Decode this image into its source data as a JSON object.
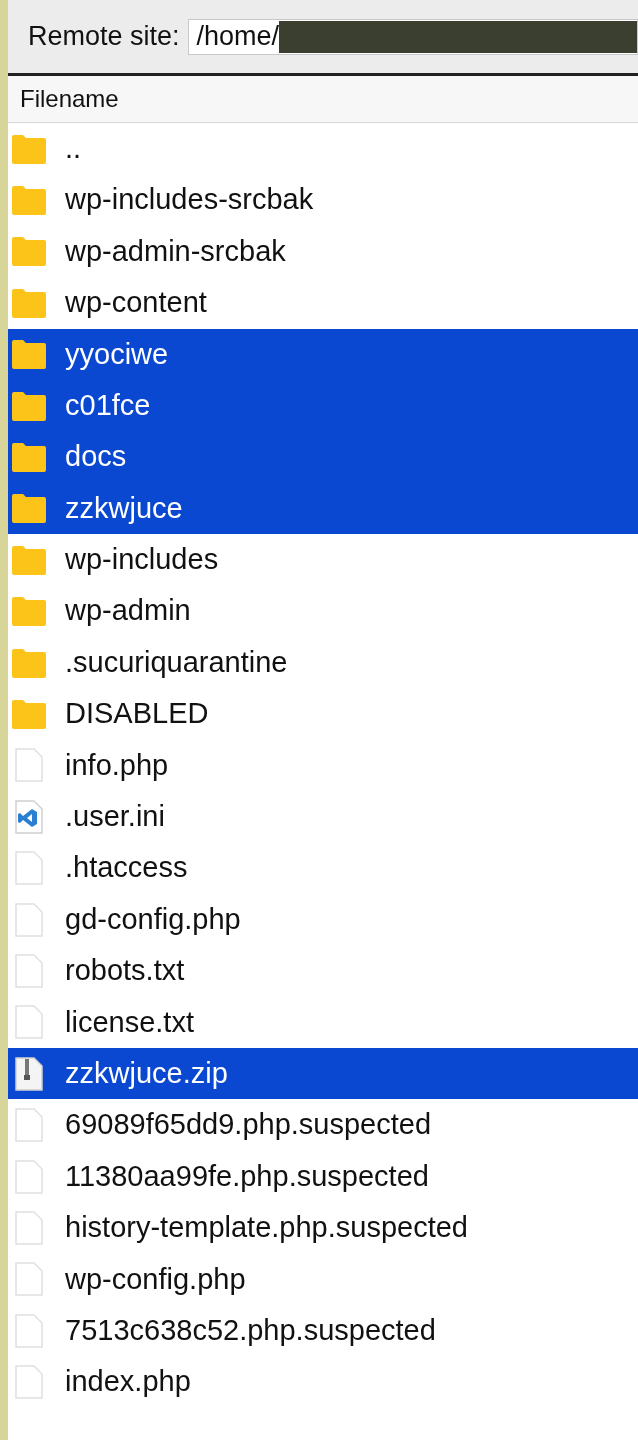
{
  "remote_site": {
    "label": "Remote site:",
    "path": "/home/"
  },
  "table": {
    "columns": [
      "Filename"
    ],
    "rows": [
      {
        "name": "..",
        "kind": "folder",
        "selected": false
      },
      {
        "name": "wp-includes-srcbak",
        "kind": "folder",
        "selected": false
      },
      {
        "name": "wp-admin-srcbak",
        "kind": "folder",
        "selected": false
      },
      {
        "name": "wp-content",
        "kind": "folder",
        "selected": false
      },
      {
        "name": "yyociwe",
        "kind": "folder",
        "selected": true
      },
      {
        "name": "c01fce",
        "kind": "folder",
        "selected": true
      },
      {
        "name": "docs",
        "kind": "folder",
        "selected": true
      },
      {
        "name": "zzkwjuce",
        "kind": "folder",
        "selected": true
      },
      {
        "name": "wp-includes",
        "kind": "folder",
        "selected": false
      },
      {
        "name": "wp-admin",
        "kind": "folder",
        "selected": false
      },
      {
        "name": ".sucuriquarantine",
        "kind": "folder",
        "selected": false
      },
      {
        "name": "DISABLED",
        "kind": "folder",
        "selected": false
      },
      {
        "name": "info.php",
        "kind": "file",
        "selected": false
      },
      {
        "name": ".user.ini",
        "kind": "code",
        "selected": false
      },
      {
        "name": ".htaccess",
        "kind": "file",
        "selected": false
      },
      {
        "name": "gd-config.php",
        "kind": "file",
        "selected": false
      },
      {
        "name": "robots.txt",
        "kind": "file",
        "selected": false
      },
      {
        "name": "license.txt",
        "kind": "file",
        "selected": false
      },
      {
        "name": "zzkwjuce.zip",
        "kind": "zip",
        "selected": true
      },
      {
        "name": "69089f65dd9.php.suspected",
        "kind": "file",
        "selected": false
      },
      {
        "name": "11380aa99fe.php.suspected",
        "kind": "file",
        "selected": false
      },
      {
        "name": "history-template.php.suspected",
        "kind": "file",
        "selected": false
      },
      {
        "name": "wp-config.php",
        "kind": "file",
        "selected": false
      },
      {
        "name": "7513c638c52.php.suspected",
        "kind": "file",
        "selected": false
      },
      {
        "name": "index.php",
        "kind": "file",
        "selected": false
      }
    ]
  }
}
